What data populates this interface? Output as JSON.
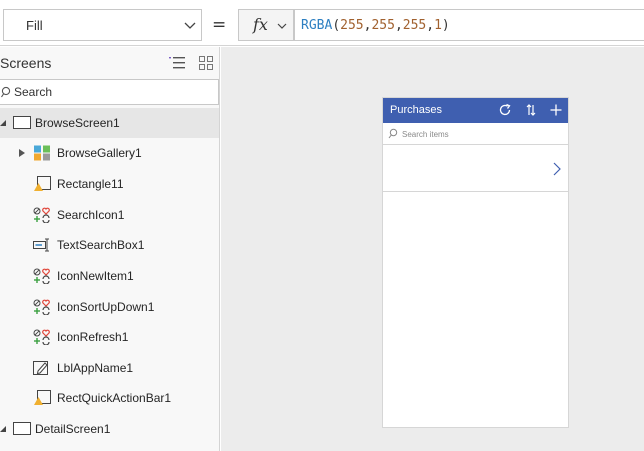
{
  "formula_bar": {
    "property": "Fill",
    "equals": "=",
    "fx_label": "fx",
    "formula": {
      "fn": "RGBA",
      "open": "(",
      "r": "255",
      "sep1": ",",
      "g": "255",
      "sep2": ",",
      "b": "255",
      "sep3": ",",
      "a": "1",
      "close": ")"
    }
  },
  "tree": {
    "title": "Screens",
    "search_placeholder": "Search",
    "items": [
      {
        "label": "BrowseScreen1",
        "icon": "screen-icon",
        "selected": true
      },
      {
        "label": "BrowseGallery1",
        "icon": "gallery-icon"
      },
      {
        "label": "Rectangle11",
        "icon": "shape-icon"
      },
      {
        "label": "SearchIcon1",
        "icon": "icon-control-icon"
      },
      {
        "label": "TextSearchBox1",
        "icon": "text-input-icon"
      },
      {
        "label": "IconNewItem1",
        "icon": "icon-control-icon"
      },
      {
        "label": "IconSortUpDown1",
        "icon": "icon-control-icon"
      },
      {
        "label": "IconRefresh1",
        "icon": "icon-control-icon"
      },
      {
        "label": "LblAppName1",
        "icon": "label-icon"
      },
      {
        "label": "RectQuickActionBar1",
        "icon": "shape-icon"
      },
      {
        "label": "DetailScreen1",
        "icon": "screen-icon"
      }
    ]
  },
  "app_preview": {
    "title": "Purchases",
    "search_placeholder": "Search items",
    "header_color": "#3f5fb0"
  }
}
